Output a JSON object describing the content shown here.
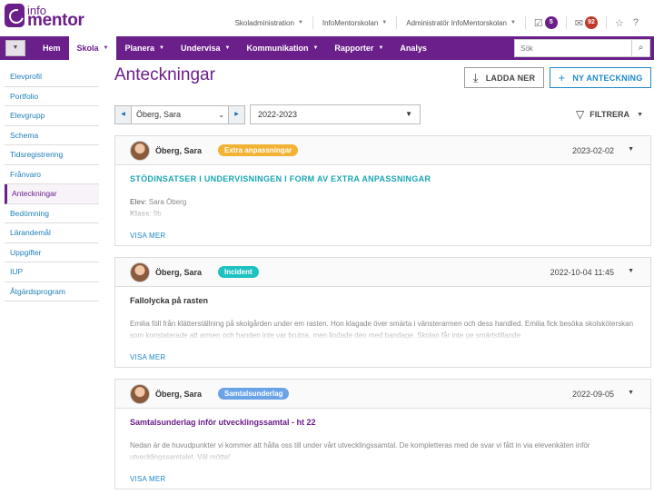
{
  "app": {
    "logo_top": "info",
    "logo_bottom": "mentor"
  },
  "topnav": {
    "school_admin": "Skoladministration",
    "school": "InfoMentorskolan",
    "user": "Administratör InfoMentorskolan",
    "notif_count": "5",
    "mail_count": "92"
  },
  "mainnav": {
    "items": [
      {
        "label": "Hem",
        "caret": false
      },
      {
        "label": "Skola",
        "caret": true
      },
      {
        "label": "Planera",
        "caret": true
      },
      {
        "label": "Undervisa",
        "caret": true
      },
      {
        "label": "Kommunikation",
        "caret": true
      },
      {
        "label": "Rapporter",
        "caret": true
      },
      {
        "label": "Analys",
        "caret": false
      }
    ],
    "search_placeholder": "Sök"
  },
  "sidebar": {
    "items": [
      "Elevprofil",
      "Portfolio",
      "Elevgrupp",
      "Schema",
      "Tidsregistrering",
      "Frånvaro",
      "Anteckningar",
      "Bedömning",
      "Lärandemål",
      "Uppgifter",
      "IUP",
      "Åtgärdsprogram"
    ]
  },
  "page": {
    "title": "Anteckningar",
    "download_label": "LADDA NER",
    "new_label": "NY ANTECKNING",
    "student": "Öberg, Sara",
    "year": "2022-2023",
    "filter_label": "FILTRERA"
  },
  "cards": [
    {
      "name": "Öberg, Sara",
      "tag": "Extra anpassningar",
      "date": "2023-02-02",
      "title": "STÖDINSATSER I UNDERVISNINGEN I FORM AV EXTRA ANPASSNINGAR",
      "line1_label": "Elev",
      "line1_value": ": Sara Öberg",
      "line2_label": "Klass",
      "line2_value": ": 9b",
      "more": "VISA MER"
    },
    {
      "name": "Öberg, Sara",
      "tag": "Incident",
      "date": "2022-10-04 11:45",
      "title": "Fallolycka på rasten",
      "text": "Emilia föll från klätterställning på skolgården under em rasten. Hon klagade över smärta i vänsterarmen och dess handled. Emilia fick besöka skolsköterskan som konstaterade att armen och handen inte var brutna, men lindade den med bandage. Skolan får inte ge smärtstillande",
      "more": "VISA MER"
    },
    {
      "name": "Öberg, Sara",
      "tag": "Samtalsunderlag",
      "date": "2022-09-05",
      "title": "Samtalsunderlag inför utvecklingssamtal - ht 22",
      "text": "Nedan är de huvudpunkter vi kommer att hålla oss till under vårt utvecklingssamtal. De kompletteras med de svar vi fått in via elevenkäten inför utvecklingssamtalet. Väl mötta!",
      "more": "VISA MER"
    }
  ],
  "colors": {
    "brand": "#6b1f8a",
    "link": "#1e88c7",
    "tag_extra": "#f2b233",
    "tag_incident": "#1ec2c2",
    "tag_samtal": "#6aa3e8",
    "notif_badge": "#6b1f8a",
    "mail_badge": "#c0392b"
  }
}
